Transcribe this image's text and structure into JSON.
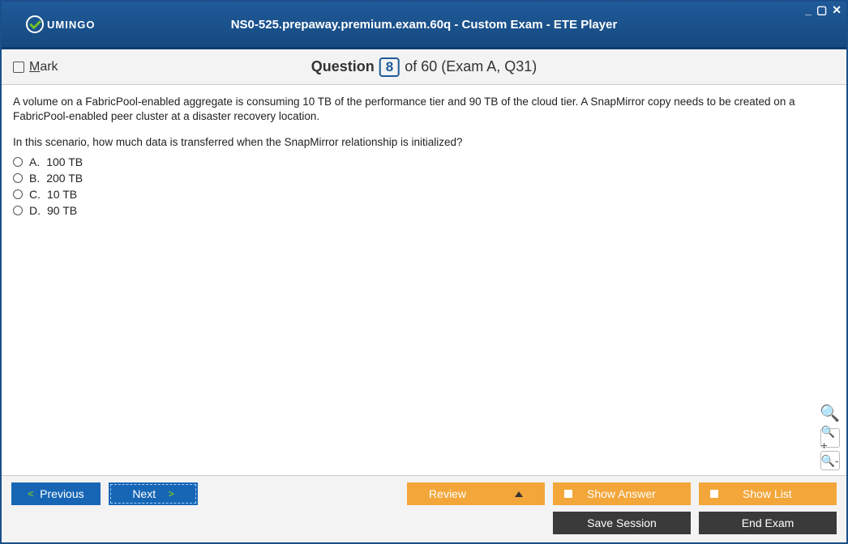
{
  "window": {
    "title": "NS0-525.prepaway.premium.exam.60q - Custom Exam - ETE Player",
    "logo_text": "UMINGO"
  },
  "subheader": {
    "mark_label_first": "M",
    "mark_label_rest": "ark",
    "question_word": "Question",
    "current_number": "8",
    "of_text": "of 60 (Exam A, Q31)"
  },
  "question": {
    "stem1": "A volume on a FabricPool-enabled aggregate is consuming 10 TB of the performance tier and 90 TB of the cloud tier. A SnapMirror copy needs to be created on a FabricPool-enabled peer cluster at a disaster recovery location.",
    "stem2": "In this scenario, how much data is transferred when the SnapMirror relationship is initialized?",
    "options": [
      {
        "letter": "A.",
        "text": "100 TB"
      },
      {
        "letter": "B.",
        "text": "200 TB"
      },
      {
        "letter": "C.",
        "text": "10 TB"
      },
      {
        "letter": "D.",
        "text": "90 TB"
      }
    ]
  },
  "footer": {
    "previous": "Previous",
    "next": "Next",
    "review": "Review",
    "show_answer": "Show Answer",
    "show_list": "Show List",
    "save_session": "Save Session",
    "end_exam": "End Exam"
  }
}
